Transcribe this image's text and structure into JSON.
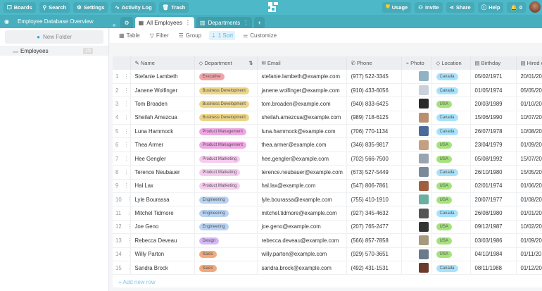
{
  "topbar": {
    "boards": "Boards",
    "search": "Search",
    "settings": "Settings",
    "activity": "Activity Log",
    "trash": "Trash",
    "usage": "Usage",
    "invite": "Invite",
    "share": "Share",
    "help": "Help",
    "notifications": "0"
  },
  "sidebar": {
    "title": "Employee Database Overview",
    "new_folder": "New Folder",
    "folder": "Employees",
    "folder_count": "15"
  },
  "tabs": [
    {
      "label": "All Employees"
    },
    {
      "label": "Departments"
    }
  ],
  "toolbar": {
    "table": "Table",
    "filter": "Filter",
    "group": "Group",
    "sort": "1 Sort",
    "customize": "Customize"
  },
  "columns": [
    "Name",
    "Department",
    "Email",
    "Phone",
    "Photo",
    "Location",
    "Birthday",
    "Hired o"
  ],
  "rows": [
    [
      "Stefanie Lambeth",
      "Executive",
      "stefanie.lambeth@example.com",
      "(977) 522-3345",
      "Canada",
      "05/02/1971",
      "20/01/20"
    ],
    [
      "Janene Wolfinger",
      "Business Development",
      "janene.wolfinger@example.com",
      "(910) 433-6056",
      "Canada",
      "01/05/1974",
      "05/05/20"
    ],
    [
      "Tom Broaden",
      "Business Development",
      "tom.broaden@example.com",
      "(940) 833-6425",
      "USA",
      "20/03/1989",
      "01/10/20"
    ],
    [
      "Sheilah Amezcua",
      "Business Development",
      "sheilah.amezcua@example.com",
      "(989) 718-6125",
      "Canada",
      "15/06/1990",
      "10/07/20"
    ],
    [
      "Luna Hammock",
      "Product Management",
      "luna.hammock@example.com",
      "(706) 770-1134",
      "Canada",
      "26/07/1978",
      "10/08/20"
    ],
    [
      "Thea Armer",
      "Product Management",
      "thea.armer@example.com",
      "(346) 835-9817",
      "USA",
      "23/04/1979",
      "01/09/20"
    ],
    [
      "Hee Gengler",
      "Product Marketing",
      "hee.gengler@example.com",
      "(702) 566-7500",
      "USA",
      "05/08/1992",
      "15/07/20"
    ],
    [
      "Terence Neubauer",
      "Product Marketing",
      "terence.neubauer@example.com",
      "(673) 527-5449",
      "Canada",
      "26/10/1980",
      "15/05/20"
    ],
    [
      "Hal Lax",
      "Product Marketing",
      "hal.lax@example.com",
      "(547) 806-7861",
      "USA",
      "02/01/1974",
      "01/06/20"
    ],
    [
      "Lyle Bourassa",
      "Engineering",
      "lyle.bourassa@example.com",
      "(755) 410-1910",
      "USA",
      "20/07/1977",
      "01/08/20"
    ],
    [
      "Mitchel Tidmore",
      "Engineering",
      "mitchel.tidmore@example.com",
      "(927) 345-4632",
      "Canada",
      "26/08/1980",
      "01/01/20"
    ],
    [
      "Joe Geno",
      "Engineering",
      "joe.geno@example.com",
      "(207) 765-2477",
      "USA",
      "09/12/1987",
      "10/02/20"
    ],
    [
      "Rebecca Deveau",
      "Design",
      "rebecca.deveau@example.com",
      "(566) 857-7858",
      "USA",
      "03/03/1986",
      "01/09/20"
    ],
    [
      "Willy Parton",
      "Sales",
      "willy.parton@example.com",
      "(929) 570-3651",
      "USA",
      "04/10/1984",
      "01/11/20"
    ],
    [
      "Sandra Brock",
      "Sales",
      "sandra.brock@example.com",
      "(492) 431-1531",
      "Canada",
      "08/11/1988",
      "01/12/20"
    ]
  ],
  "dept_colors": {
    "Executive": "#f1a3a8",
    "Business Development": "#ecd588",
    "Product Management": "#f0a8e4",
    "Product Marketing": "#f6ccee",
    "Engineering": "#b8d3f2",
    "Design": "#d5b9f5",
    "Sales": "#f2aa7c"
  },
  "location_colors": {
    "Canada": "#a9e2fb",
    "USA": "#a6e27c"
  },
  "add_row": "+ Add new row"
}
